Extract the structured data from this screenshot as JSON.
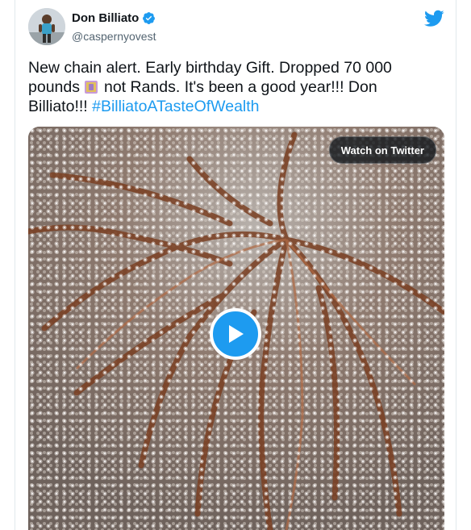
{
  "author": {
    "name": "Don Billiato",
    "handle": "@caspernyovest"
  },
  "tweet": {
    "text_part1": "New chain alert. Early birthday Gift. Dropped 70 000 pounds",
    "emoji": "money-with-wings-icon",
    "text_part2": "not Rands. It's been a good year!!! Don Billiato!!!",
    "hashtag": "#BilliatoATasteOfWealth"
  },
  "media": {
    "watch_label": "Watch on Twitter"
  },
  "colors": {
    "accent": "#1d9bf0",
    "text": "#0f1419",
    "muted": "#536471"
  }
}
